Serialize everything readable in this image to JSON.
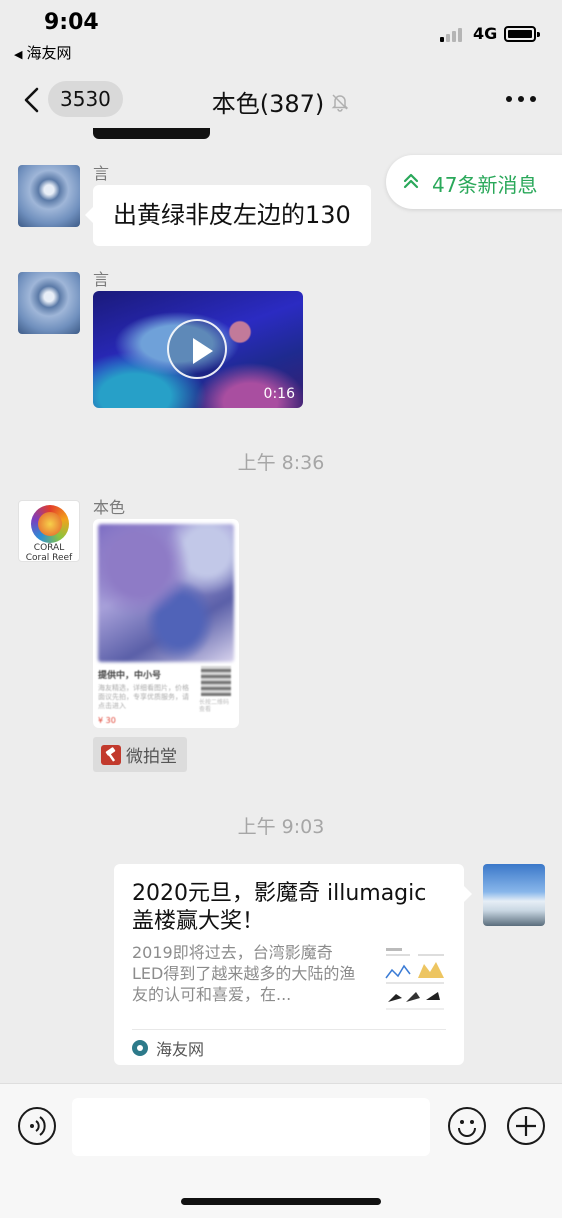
{
  "status_bar": {
    "time": "9:04",
    "back_app": "海友网",
    "network": "4G"
  },
  "nav": {
    "back_count": "3530",
    "title": "本色(387)"
  },
  "new_messages": {
    "label": "47条新消息",
    "color": "#2aa85a"
  },
  "messages": [
    {
      "sender": "言",
      "text": "出黄绿非皮左边的130"
    },
    {
      "sender": "言",
      "type": "video",
      "duration": "0:16"
    }
  ],
  "divider_1": "上午 8:36",
  "mini_program": {
    "sender": "本色",
    "avatar_caption_1": "CORAL",
    "avatar_caption_2": "Coral Reef",
    "card_title": "提供中，中小号",
    "card_desc": "海友精选，详细看图片，价格面议先拍，专享优质服务，请点击进入",
    "card_price": "¥ 30",
    "card_qr_note": "长按二维码查看",
    "source_label": "微拍堂"
  },
  "divider_2": "上午 9:03",
  "link_card": {
    "title": "2020元旦，影魔奇 illumagic 盖楼赢大奖！",
    "description": "2019即将过去，台湾影魔奇LED得到了越来越多的大陆的渔友的认可和喜爱，在...",
    "source": "海友网"
  },
  "input": {
    "placeholder": ""
  },
  "icons": {
    "back": "chevron-left-icon",
    "mute": "bell-off-icon",
    "more": "more-icon",
    "new_msg": "double-chevron-up-icon",
    "play": "play-icon",
    "voice": "voice-icon",
    "emoji": "emoji-icon",
    "plus": "plus-icon"
  }
}
